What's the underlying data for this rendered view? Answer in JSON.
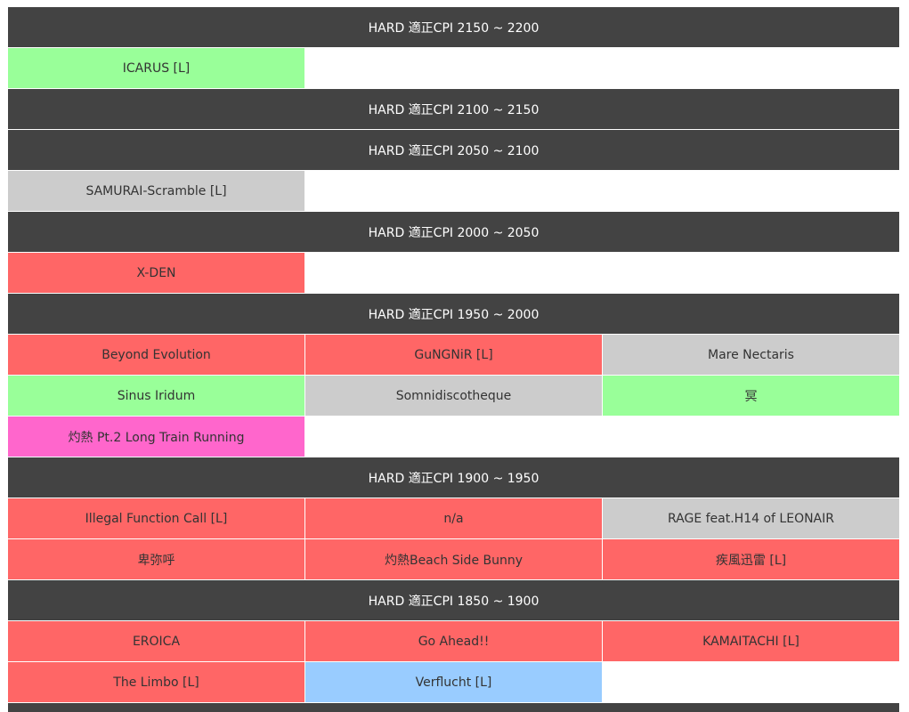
{
  "colors": {
    "header_bg": "#434343",
    "green": "#99ff99",
    "gray": "#cccccc",
    "red": "#ff6666",
    "pink": "#ff66cc",
    "blue": "#99ccff",
    "empty": "#ffffff"
  },
  "sections": [
    {
      "header": "HARD 適正CPI 2150 ~ 2200",
      "rows": [
        [
          {
            "label": "ICARUS [L]",
            "color": "green"
          },
          null,
          null
        ]
      ]
    },
    {
      "header": "HARD 適正CPI 2100 ~ 2150",
      "rows": []
    },
    {
      "header": "HARD 適正CPI 2050 ~ 2100",
      "rows": [
        [
          {
            "label": "SAMURAI-Scramble [L]",
            "color": "gray"
          },
          null,
          null
        ]
      ]
    },
    {
      "header": "HARD 適正CPI 2000 ~ 2050",
      "rows": [
        [
          {
            "label": "X-DEN",
            "color": "red"
          },
          null,
          null
        ]
      ]
    },
    {
      "header": "HARD 適正CPI 1950 ~ 2000",
      "rows": [
        [
          {
            "label": "Beyond Evolution",
            "color": "red"
          },
          {
            "label": "GuNGNiR [L]",
            "color": "red"
          },
          {
            "label": "Mare Nectaris",
            "color": "gray"
          }
        ],
        [
          {
            "label": "Sinus Iridum",
            "color": "green"
          },
          {
            "label": "Somnidiscotheque",
            "color": "gray"
          },
          {
            "label": "冥",
            "color": "green"
          }
        ],
        [
          {
            "label": "灼熱 Pt.2 Long Train Running",
            "color": "pink"
          },
          null,
          null
        ]
      ]
    },
    {
      "header": "HARD 適正CPI 1900 ~ 1950",
      "rows": [
        [
          {
            "label": "Illegal Function Call [L]",
            "color": "red"
          },
          {
            "label": "n/a",
            "color": "red"
          },
          {
            "label": "RAGE feat.H14 of LEONAIR",
            "color": "gray"
          }
        ],
        [
          {
            "label": "卑弥呼",
            "color": "red"
          },
          {
            "label": "灼熱Beach Side Bunny",
            "color": "red"
          },
          {
            "label": "疾風迅雷 [L]",
            "color": "red"
          }
        ]
      ]
    },
    {
      "header": "HARD 適正CPI 1850 ~ 1900",
      "rows": [
        [
          {
            "label": "EROICA",
            "color": "red"
          },
          {
            "label": "Go Ahead!!",
            "color": "red"
          },
          {
            "label": "KAMAITACHI [L]",
            "color": "red"
          }
        ],
        [
          {
            "label": "The Limbo [L]",
            "color": "red"
          },
          {
            "label": "Verflucht [L]",
            "color": "blue"
          },
          null
        ]
      ]
    }
  ]
}
